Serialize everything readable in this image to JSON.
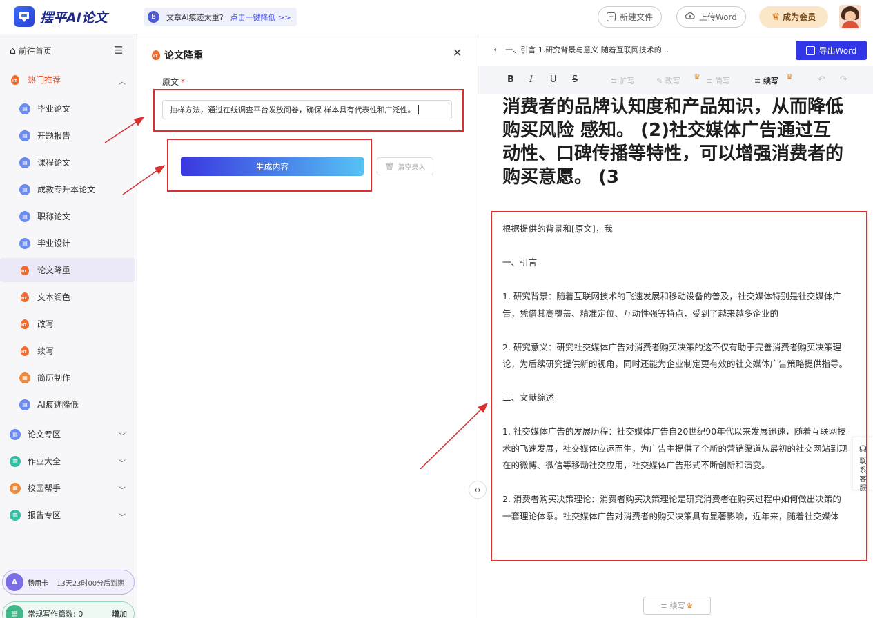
{
  "header": {
    "logo_text": "摆平AI论文",
    "notice_icon": "B",
    "notice_text": "文章AI痕迹太重?",
    "notice_link": "点击一键降低 >>",
    "new_file": "新建文件",
    "upload_word": "上传Word",
    "vip": "成为会员"
  },
  "sidebar": {
    "home": "前往首页",
    "hot_group": "热门推荐",
    "items": [
      {
        "label": "毕业论文",
        "icon": "doc-icon"
      },
      {
        "label": "开题报告",
        "icon": "doc-icon"
      },
      {
        "label": "课程论文",
        "icon": "doc-icon"
      },
      {
        "label": "成教专升本论文",
        "icon": "doc-icon"
      },
      {
        "label": "职称论文",
        "icon": "doc-icon"
      },
      {
        "label": "毕业设计",
        "icon": "doc-icon"
      },
      {
        "label": "论文降重",
        "icon": "flame-icon"
      },
      {
        "label": "文本润色",
        "icon": "flame-icon"
      },
      {
        "label": "改写",
        "icon": "flame-icon"
      },
      {
        "label": "续写",
        "icon": "flame-icon"
      },
      {
        "label": "简历制作",
        "icon": "resume-icon"
      },
      {
        "label": "AI痕迹降低",
        "icon": "doc-icon"
      }
    ],
    "groups": [
      "论文专区",
      "作业大全",
      "校园帮手",
      "报告专区"
    ],
    "card_pill": {
      "name": "畅用卡",
      "expire": "13天23时00分后到期"
    },
    "count_pill": {
      "label": "常规写作篇数: 0",
      "action": "增加"
    }
  },
  "panel": {
    "title": "论文降重",
    "source_label": "原文",
    "source_value": "抽样方法，通过在线调查平台发放问卷，确保 样本具有代表性和广泛性。",
    "generate": "生成内容",
    "clear": "清空录入"
  },
  "editor": {
    "breadcrumb": "一、引言 1.研究背景与意义 随着互联网技术的...",
    "export": "导出Word",
    "tools": {
      "bold": "B",
      "italic": "I",
      "underline": "U",
      "strike": "S",
      "expand": "扩写",
      "rewrite": "改写",
      "shorten": "简写",
      "continue": "续写"
    },
    "headline": "消费者的品牌认知度和产品知识，从而降低购买风险 感知。 (2)社交媒体广告通过互动性、口碑传播等特性，可以增强消费者的购买意愿。 (3",
    "paragraphs": [
      "根据提供的背景和[原文]，我",
      "一、引言",
      "1. 研究背景：随着互联网技术的飞速发展和移动设备的普及，社交媒体特别是社交媒体广告，凭借其高覆盖、精准定位、互动性强等特点，受到了越来越多企业的",
      "2. 研究意义：研究社交媒体广告对消费者购买决策的这不仅有助于完善消费者购买决策理论，为后续研究提供新的视角，同时还能为企业制定更有效的社交媒体广告策略提供指导。",
      "二、文献综述",
      "1. 社交媒体广告的发展历程：社交媒体广告自20世纪90年代以来发展迅速，随着互联网技术的飞速发展，社交媒体应运而生，为广告主提供了全新的营销渠道从最初的社交网站到现在的微博、微信等移动社交应用，社交媒体广告形式不断创新和演变。",
      "2. 消费者购买决策理论：消费者购买决策理论是研究消费者在购买过程中如何做出决策的一套理论体系。社交媒体广告对消费者的购买决策具有显著影响，近年来，随着社交媒体"
    ],
    "bottom_continue": "续写",
    "contact": "联系客服"
  }
}
